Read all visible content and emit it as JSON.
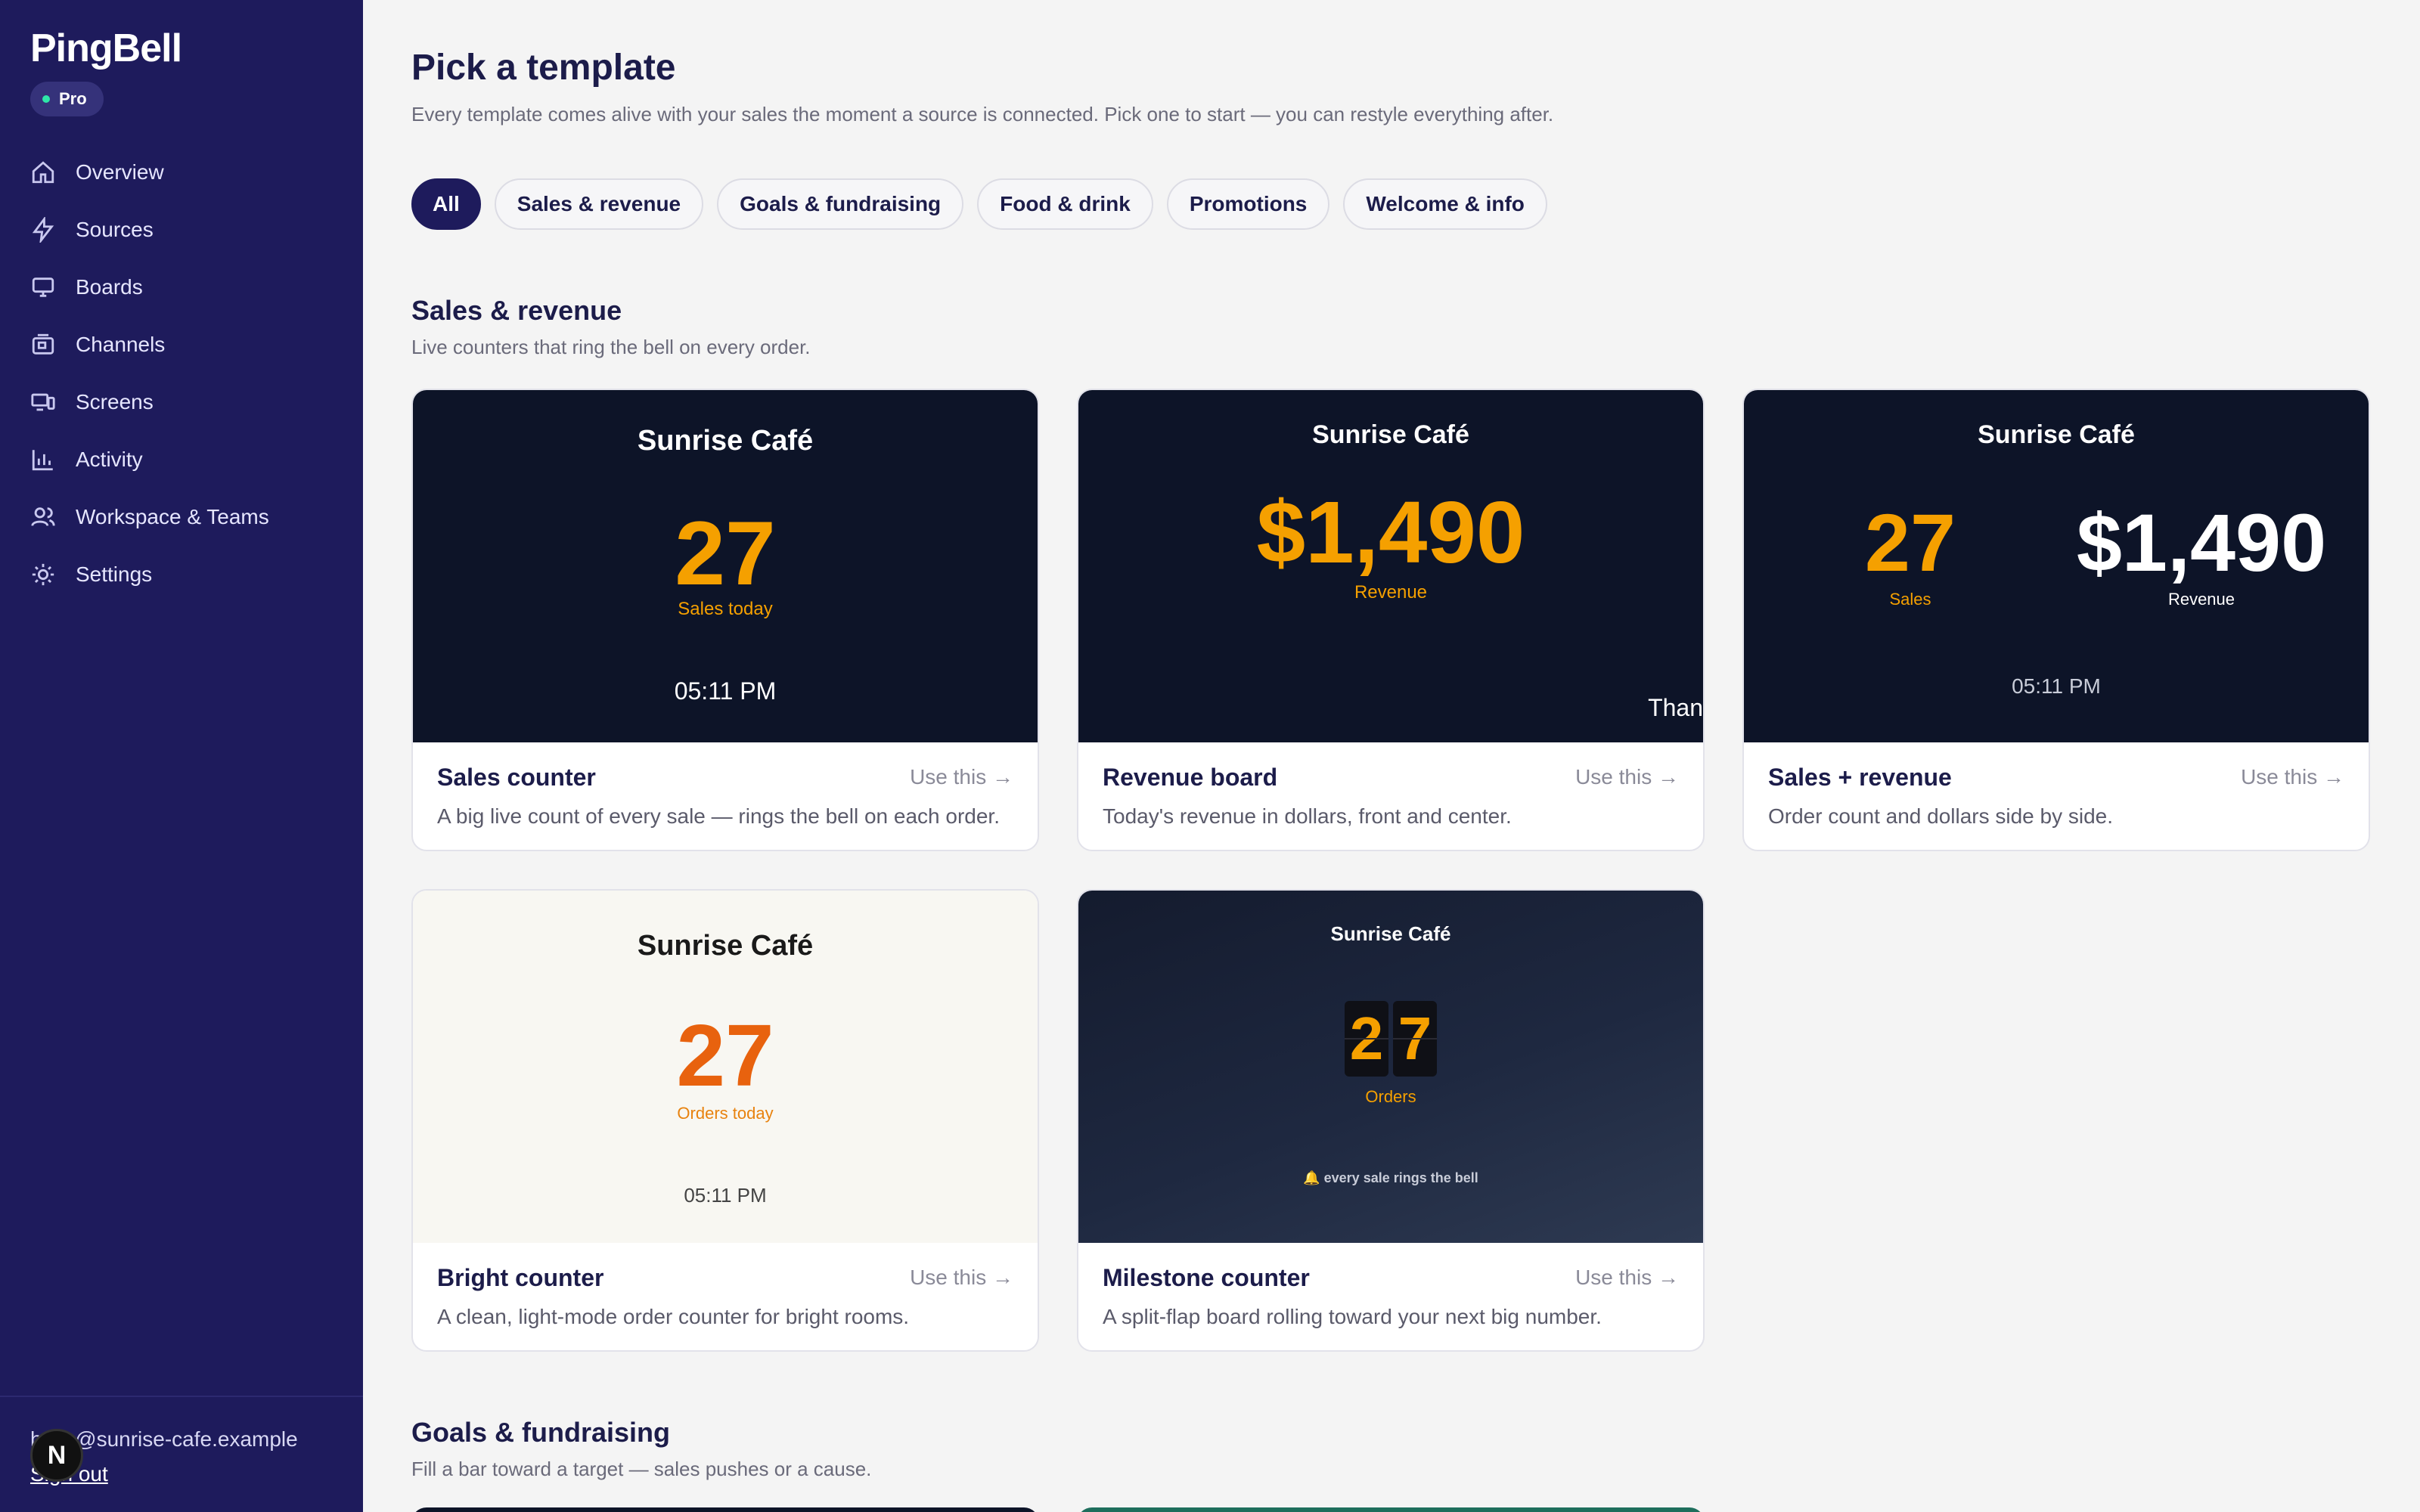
{
  "app": {
    "brand": "PingBell",
    "plan": "Pro"
  },
  "nav": [
    {
      "label": "Overview",
      "icon": "home-icon"
    },
    {
      "label": "Sources",
      "icon": "bolt-icon"
    },
    {
      "label": "Boards",
      "icon": "monitor-icon"
    },
    {
      "label": "Channels",
      "icon": "channels-icon"
    },
    {
      "label": "Screens",
      "icon": "screens-icon"
    },
    {
      "label": "Activity",
      "icon": "chart-icon"
    },
    {
      "label": "Workspace & Teams",
      "icon": "users-icon"
    },
    {
      "label": "Settings",
      "icon": "gear-icon"
    }
  ],
  "user": {
    "email": "hello@sunrise-cafe.example",
    "sign_out": "Sign out",
    "avatar": "N"
  },
  "page": {
    "title": "Pick a template",
    "subtitle": "Every template comes alive with your sales the moment a source is connected. Pick one to start — you can restyle everything after."
  },
  "filters": [
    "All",
    "Sales & revenue",
    "Goals & fundraising",
    "Food & drink",
    "Promotions",
    "Welcome & info"
  ],
  "sections": {
    "sales": {
      "title": "Sales & revenue",
      "subtitle": "Live counters that ring the bell on every order."
    },
    "goals": {
      "title": "Goals & fundraising",
      "subtitle": "Fill a bar toward a target — sales pushes or a cause."
    }
  },
  "cards": {
    "sales_counter": {
      "name": "Sales counter",
      "use": "Use this →",
      "desc": "A big live count of every sale — rings the bell on each order.",
      "cafe": "Sunrise Café",
      "value": "27",
      "caption": "Sales today",
      "time": "05:11 PM"
    },
    "revenue_board": {
      "name": "Revenue board",
      "use": "Use this →",
      "desc": "Today's revenue in dollars, front and center.",
      "cafe": "Sunrise Café",
      "value": "$1,490",
      "caption": "Revenue",
      "ticker": "Than"
    },
    "sales_revenue": {
      "name": "Sales + revenue",
      "use": "Use this →",
      "desc": "Order count and dollars side by side.",
      "cafe": "Sunrise Café",
      "count": "27",
      "count_caption": "Sales",
      "amount": "$1,490",
      "amount_caption": "Revenue",
      "time": "05:11 PM"
    },
    "bright_counter": {
      "name": "Bright counter",
      "use": "Use this →",
      "desc": "A clean, light-mode order counter for bright rooms.",
      "cafe": "Sunrise Café",
      "value": "27",
      "caption": "Orders today",
      "time": "05:11 PM"
    },
    "milestone_counter": {
      "name": "Milestone counter",
      "use": "Use this →",
      "desc": "A split-flap board rolling toward your next big number.",
      "cafe": "Sunrise Café",
      "digit1": "2",
      "digit2": "7",
      "caption": "Orders",
      "tagline": "🔔 every sale rings the bell"
    }
  },
  "colors": {
    "sidebar": "#1e1b5c",
    "accent": "#f5a000",
    "bright_accent": "#e8620e",
    "dark_preview": "#0d1428"
  }
}
